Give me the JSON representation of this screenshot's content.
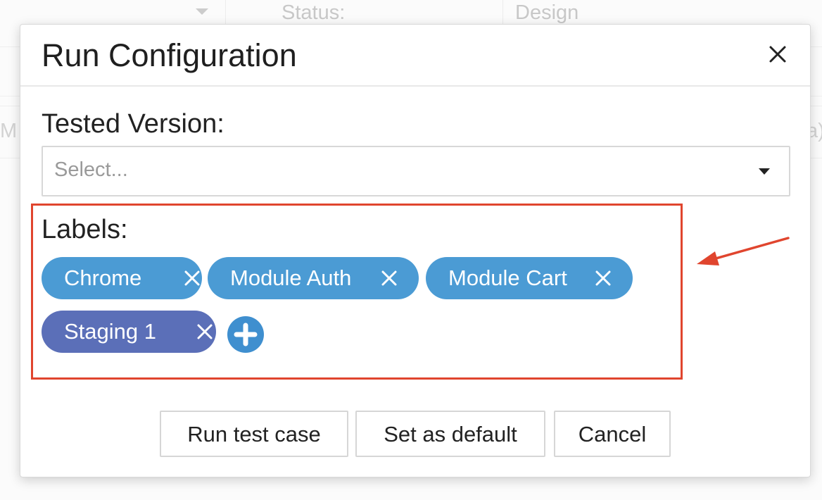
{
  "background": {
    "status_label": "Status:",
    "status_value": "Design",
    "left_fragment": "M",
    "right_fragment": "a)"
  },
  "modal": {
    "title": "Run Configuration",
    "close_icon": "close-icon"
  },
  "tested_version": {
    "label": "Tested Version:",
    "placeholder": "Select..."
  },
  "labels": {
    "label": "Labels:",
    "chips": [
      {
        "text": "Chrome",
        "color": "#4b9bd4"
      },
      {
        "text": "Module Auth",
        "color": "#4b9bd4"
      },
      {
        "text": "Module Cart",
        "color": "#4b9bd4"
      },
      {
        "text": "Staging 1",
        "color": "#5b6fb8"
      }
    ],
    "add_icon": "plus-circle-icon"
  },
  "buttons": {
    "run": "Run test case",
    "default": "Set as default",
    "cancel": "Cancel"
  },
  "annotation": {
    "highlight_color": "#e0452e"
  }
}
